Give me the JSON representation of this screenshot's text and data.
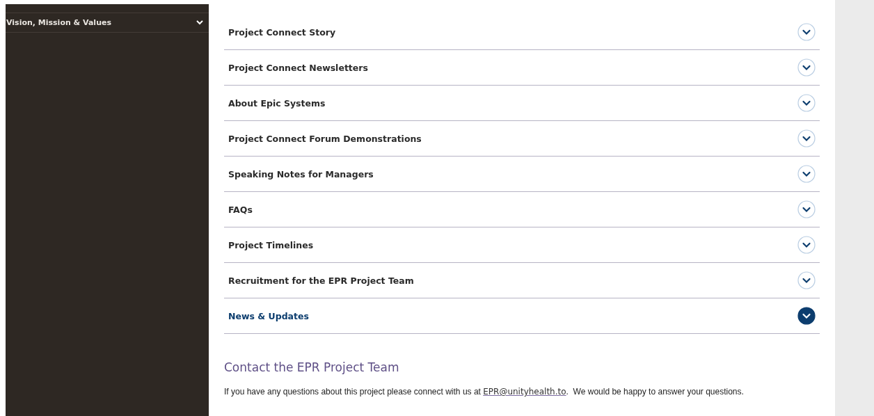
{
  "sidebar": {
    "items": [
      {
        "label": "Vision, Mission & Values",
        "expanded": false
      }
    ]
  },
  "accordion": {
    "items": [
      {
        "title": "Project Connect Story",
        "selected": false
      },
      {
        "title": "Project Connect Newsletters",
        "selected": false
      },
      {
        "title": "About Epic Systems",
        "selected": false
      },
      {
        "title": "Project Connect Forum Demonstrations",
        "selected": false
      },
      {
        "title": "Speaking Notes for Managers",
        "selected": false
      },
      {
        "title": "FAQs",
        "selected": false
      },
      {
        "title": "Project Timelines",
        "selected": false
      },
      {
        "title": "Recruitment for the EPR Project Team",
        "selected": false
      },
      {
        "title": "News & Updates",
        "selected": true
      }
    ]
  },
  "contact": {
    "heading": "Contact the EPR Project Team",
    "text_before": "If you have any questions about this project please connect with us at",
    "email": "EPR@unityhealth.to",
    "text_after": ".  We would be happy to answer your questions."
  }
}
